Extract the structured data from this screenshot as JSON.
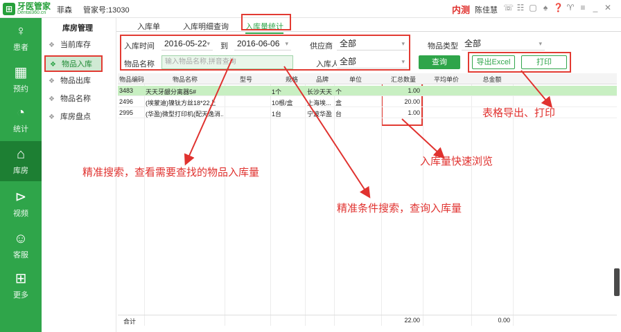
{
  "header": {
    "logo_main": "牙医管家",
    "logo_sub": "Dental360.cn",
    "user_name": "菲森",
    "manager_no": "管家号:13030",
    "env_tag": "内测",
    "current_user": "陈佳慧",
    "icons": [
      "wechat-icon",
      "chat-icon",
      "phone-icon",
      "bell-icon",
      "help-icon",
      "gift-icon",
      "menu-icon",
      "minimize-icon",
      "close-icon"
    ]
  },
  "sidebar": {
    "items": [
      {
        "label": "患者",
        "icon": "user-icon"
      },
      {
        "label": "预约",
        "icon": "calendar-icon"
      },
      {
        "label": "统计",
        "icon": "pie-chart-icon"
      },
      {
        "label": "库房",
        "icon": "warehouse-icon"
      },
      {
        "label": "视频",
        "icon": "play-icon"
      },
      {
        "label": "客服",
        "icon": "service-icon"
      },
      {
        "label": "更多",
        "icon": "grid-icon"
      }
    ]
  },
  "submenu": {
    "title": "库房管理",
    "items": [
      {
        "label": "当前库存"
      },
      {
        "label": "物品入库"
      },
      {
        "label": "物品出库"
      },
      {
        "label": "物品名称"
      },
      {
        "label": "库房盘点"
      }
    ]
  },
  "tabs": [
    {
      "label": "入库单"
    },
    {
      "label": "入库明细查询"
    },
    {
      "label": "入库量统计"
    }
  ],
  "filters": {
    "date_label": "入库时间",
    "date_from": "2016-05-22",
    "date_to_label": "到",
    "date_to": "2016-06-06",
    "supplier_label": "供应商",
    "supplier_value": "全部",
    "item_type_label": "物品类型",
    "item_type_value": "全部",
    "item_name_label": "物品名称",
    "item_name_placeholder": "输入物品名称,拼音查询",
    "person_label": "入库人",
    "person_value": "全部",
    "query_button": "查询",
    "export_button": "导出Excel",
    "print_button": "打印"
  },
  "table": {
    "columns": [
      "物品编码",
      "物品名称",
      "型号",
      "规格",
      "品牌",
      "单位",
      "汇总数量",
      "平均单价",
      "总金额"
    ],
    "rows": [
      {
        "code": "3483",
        "name": "天天牙龈分离器5#",
        "model": "",
        "spec": "1个",
        "brand": "长沙天天",
        "unit": "个",
        "qty": "1.00",
        "avg": "",
        "total": ""
      },
      {
        "code": "2496",
        "name": "(埃蒙迪)镍钛方丝18*22上",
        "model": "",
        "spec": "10根/盒",
        "brand": "上海埃...",
        "unit": "盒",
        "qty": "20.00",
        "avg": "",
        "total": ""
      },
      {
        "code": "2995",
        "name": "(华盈)微型打印机(配天逸消...",
        "model": "",
        "spec": "1台",
        "brand": "宁波华盈",
        "unit": "台",
        "qty": "1.00",
        "avg": "",
        "total": ""
      }
    ],
    "footer_label": "合计",
    "footer_qty": "22.00",
    "footer_total": "0.00"
  },
  "annotations": {
    "export_print": "表格导出、打印",
    "quick_browse": "入库量快速浏览",
    "precise_search": "精准搜索，查看需要查找的物品入库量",
    "condition_search": "精准条件搜索，查询入库量"
  },
  "colors": {
    "brand_green": "#2fa54a",
    "annotation_red": "#e0322f",
    "selected_row": "#c8efc2"
  }
}
